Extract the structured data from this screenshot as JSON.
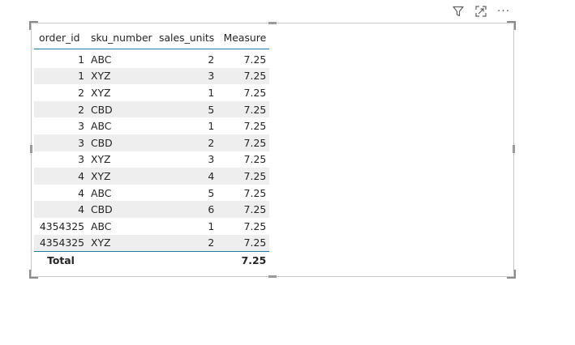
{
  "header_icons": [
    "filter-icon",
    "focus-mode-icon",
    "more-options-icon"
  ],
  "more_options_glyph": "···",
  "table": {
    "columns": [
      "order_id",
      "sku_number",
      "sales_units",
      "Measure"
    ],
    "rows": [
      [
        "1",
        "ABC",
        "2",
        "7.25"
      ],
      [
        "1",
        "XYZ",
        "3",
        "7.25"
      ],
      [
        "2",
        "XYZ",
        "1",
        "7.25"
      ],
      [
        "2",
        "CBD",
        "5",
        "7.25"
      ],
      [
        "3",
        "ABC",
        "1",
        "7.25"
      ],
      [
        "3",
        "CBD",
        "2",
        "7.25"
      ],
      [
        "3",
        "XYZ",
        "3",
        "7.25"
      ],
      [
        "4",
        "XYZ",
        "4",
        "7.25"
      ],
      [
        "4",
        "ABC",
        "5",
        "7.25"
      ],
      [
        "4",
        "CBD",
        "6",
        "7.25"
      ],
      [
        "4354325",
        "ABC",
        "1",
        "7.25"
      ],
      [
        "4354325",
        "XYZ",
        "2",
        "7.25"
      ]
    ],
    "total_label": "Total",
    "total_measure": "7.25"
  },
  "colors": {
    "accent_line": "#1a7aa8",
    "alt_row": "#eeeeee",
    "border": "#c8c8c8"
  }
}
